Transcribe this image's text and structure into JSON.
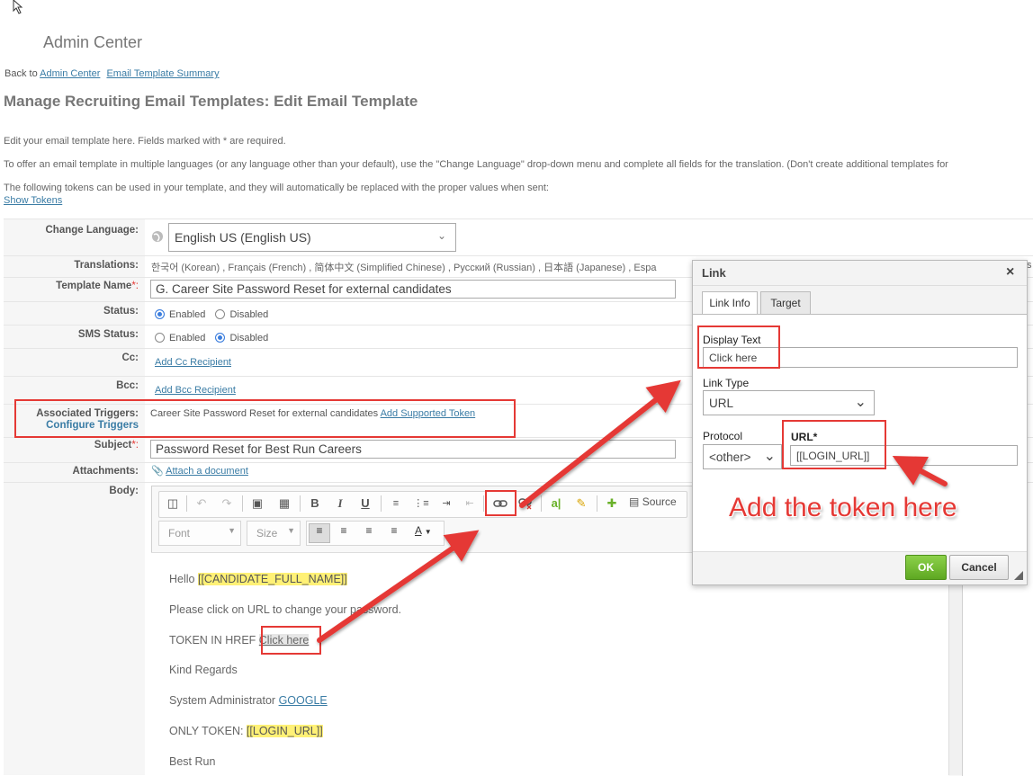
{
  "header": {
    "app_title": "Admin Center",
    "back_prefix": "Back to",
    "back_link": "Admin Center",
    "summary_link": "Email Template Summary",
    "page_title": "Manage Recruiting Email Templates: Edit Email Template"
  },
  "intro": {
    "line1": "Edit your email template here. Fields marked with * are required.",
    "line2": "To offer an email template in multiple languages (or any language other than your default), use the \"Change Language\" drop-down menu and complete all fields for the translation. (Don't create additional templates for",
    "line3": "The following tokens can be used in your template, and they will automatically be replaced with the proper values when sent:",
    "show_tokens": "Show Tokens"
  },
  "form": {
    "change_language_label": "Change Language:",
    "language_value": "English US (English US)",
    "translations_label": "Translations:",
    "translations_value": "한국어 (Korean) , Français (French) , 简体中文 (Simplified Chinese) , Русский (Russian) , 日本語 (Japanese) , Espa",
    "translations_tail": "s",
    "template_name_label": "Template Name",
    "template_name_value": "G. Career Site Password Reset for external candidates",
    "status_label": "Status:",
    "status_enabled": "Enabled",
    "status_disabled": "Disabled",
    "sms_label": "SMS Status:",
    "sms_enabled": "Enabled",
    "sms_disabled": "Disabled",
    "cc_label": "Cc:",
    "cc_link": "Add Cc Recipient",
    "bcc_label": "Bcc:",
    "bcc_link": "Add Bcc Recipient",
    "triggers_label": "Associated Triggers:",
    "configure_triggers": "Configure Triggers",
    "triggers_value": "Career Site Password Reset for external candidates",
    "add_token_link": "Add Supported Token",
    "subject_label": "Subject",
    "subject_value": "Password Reset for Best Run Careers",
    "attachments_label": "Attachments:",
    "attach_link": "Attach a document",
    "body_label": "Body:",
    "required_mark": "*:"
  },
  "editor": {
    "source_label": "Source",
    "font_label": "Font",
    "size_label": "Size",
    "body": {
      "hello": "Hello ",
      "token_name": "[[CANDIDATE_FULL_NAME]]",
      "please": "Please click on URL to change your password.",
      "token_href_prefix": "TOKEN IN HREF ",
      "click_here": "Click here",
      "regards": "Kind Regards",
      "sysadmin": "System Administrator ",
      "google": "GOOGLE",
      "only_token_prefix": "ONLY TOKEN: ",
      "login_token": "[[LOGIN_URL]]",
      "best_run": "Best Run"
    }
  },
  "dialog": {
    "title": "Link",
    "tab_link_info": "Link Info",
    "tab_target": "Target",
    "display_text_label": "Display Text",
    "display_text_value": "Click here",
    "link_type_label": "Link Type",
    "link_type_value": "URL",
    "protocol_label": "Protocol",
    "protocol_value": "<other>",
    "url_label": "URL*",
    "url_value": "[[LOGIN_URL]]",
    "ok": "OK",
    "cancel": "Cancel"
  },
  "annotation": {
    "text": "Add the token here"
  },
  "colors": {
    "accent_red": "#e53935",
    "link_blue": "#3a7ca5",
    "token_highlight": "#fff176",
    "ok_green": "#6ab12a"
  }
}
